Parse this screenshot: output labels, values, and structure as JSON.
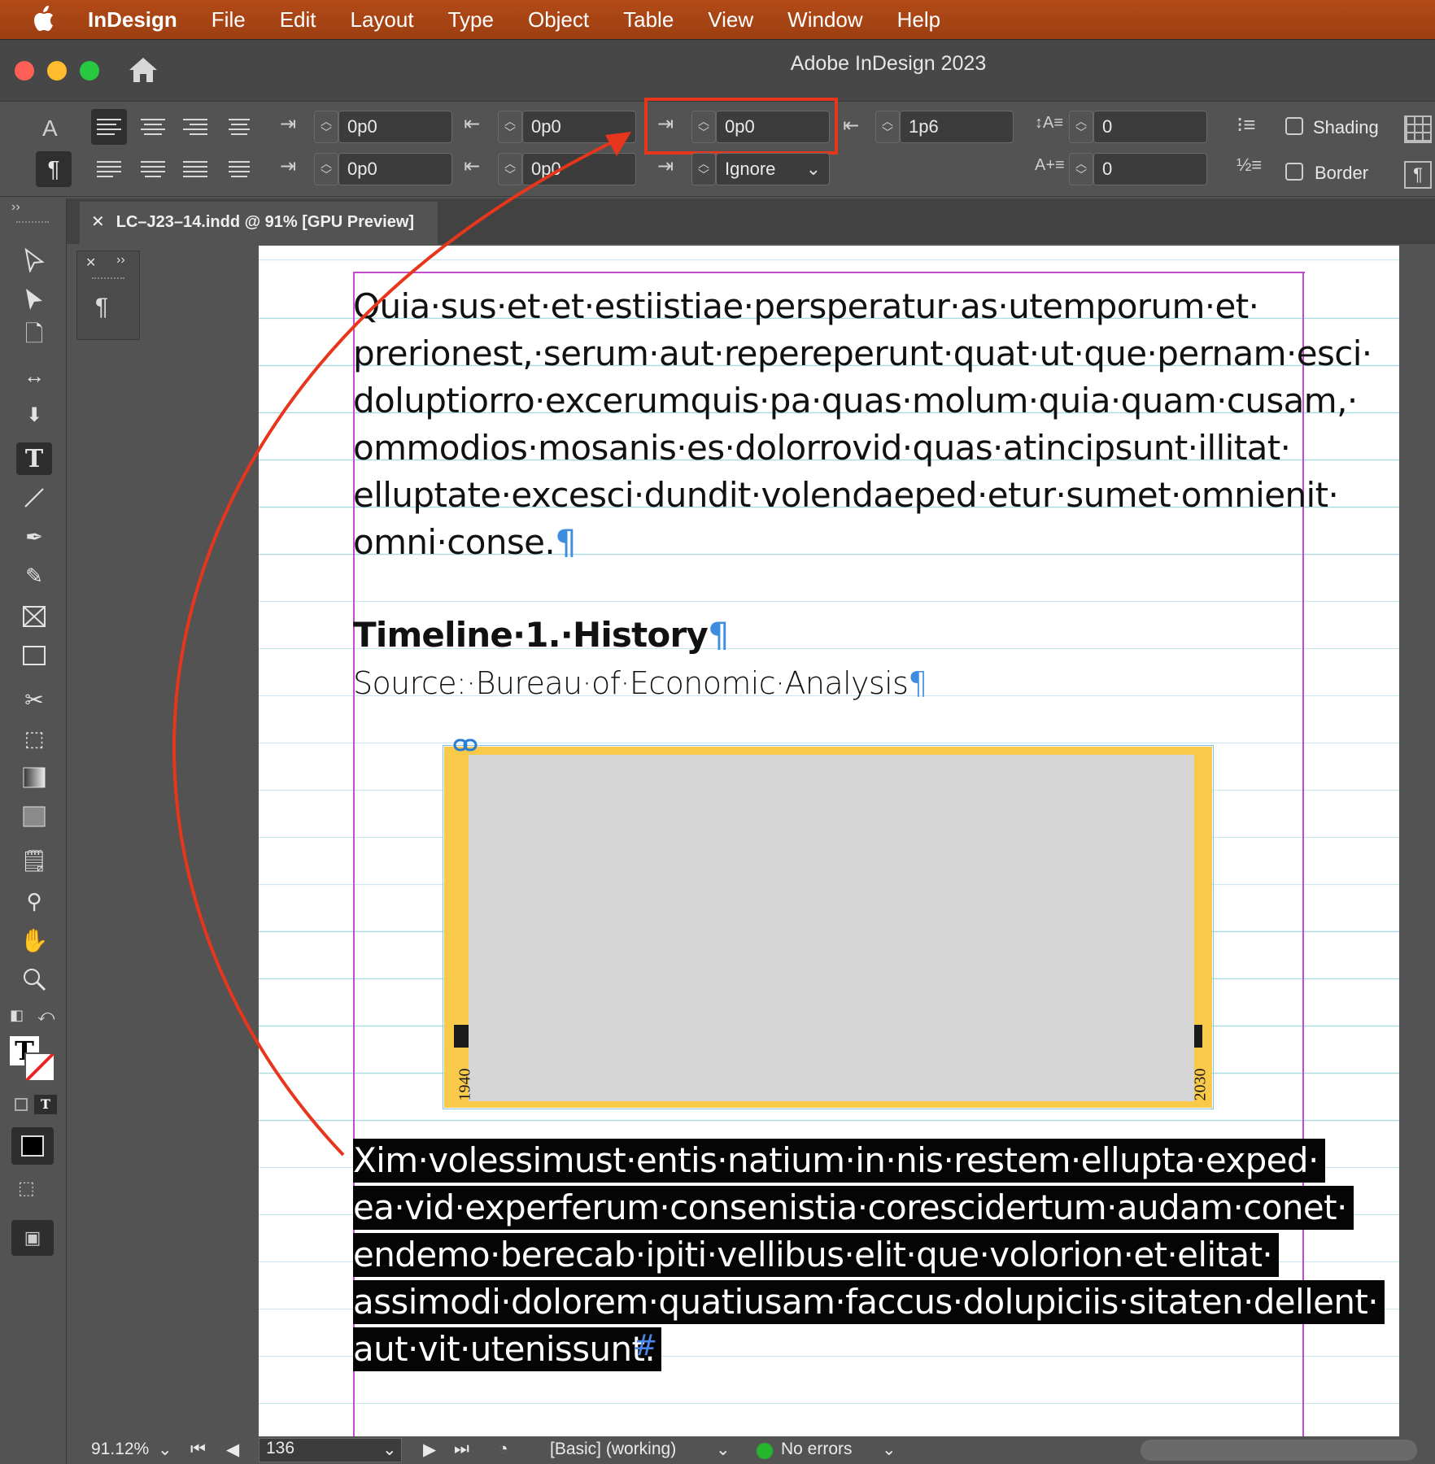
{
  "menubar": {
    "items": [
      "InDesign",
      "File",
      "Edit",
      "Layout",
      "Type",
      "Object",
      "Table",
      "View",
      "Window",
      "Help"
    ]
  },
  "window": {
    "title": "Adobe InDesign 2023"
  },
  "control_panel": {
    "left_indent": "0p0",
    "right_indent": "0p0",
    "first_line_indent": "0p0",
    "last_line_right_indent": "0p0",
    "space_before": "0p0",
    "space_after": "1p6",
    "align_to_grid": "Ignore",
    "drop_cap_lines": "0",
    "drop_cap_chars": "0",
    "shading_label": "Shading",
    "border_label": "Border"
  },
  "document_tab": {
    "title": "LC–J23–14.indd @ 91% [GPU Preview]"
  },
  "document": {
    "body_lines": [
      "Quia·sus·et·et·estiistiae·persperatur·as·utemporum·et·",
      "prerionest,·serum·aut·repereperunt·quat·ut·que·pernam·esci·",
      "doluptiorro·excerumquis·pa·quas·molum·quia·quam·cusam,·",
      "ommodios·mosanis·es·dolorrovid·quas·atincipsunt·illitat·",
      "elluptate·excesci·dundit·volendaeped·etur·sumet·omnienit·",
      "omni·conse."
    ],
    "heading": "Timeline·1.·History",
    "source": "Source:·Bureau·of·Economic·Analysis",
    "timeline_start": "1940",
    "timeline_end": "2030",
    "selected_lines": [
      "Xim·volessimust·entis·natium·in·nis·restem·ellupta·exped·",
      "ea·vid·experferum·consenistia·corescidertum·audam·conet·",
      "endemo·berecab·ipiti·vellibus·elit·que·volorion·et·elitat·",
      "assimodi·dolorem·quatiusam·faccus·dolupiciis·sitaten·dellent·",
      "aut·vit·utenissunt."
    ],
    "pilcrow": "¶",
    "end_mark": "#"
  },
  "status_bar": {
    "zoom": "91.12%",
    "page": "136",
    "preflight_profile": "[Basic] (working)",
    "errors": "No errors"
  },
  "colors": {
    "menubar": "#a8441a",
    "frame_yellow": "#f9c94a",
    "annotation_red": "#e8361c",
    "margin_magenta": "#c44ad0",
    "baseline_grid": "#a9dbe3",
    "no_errors_green": "#27b42d"
  }
}
